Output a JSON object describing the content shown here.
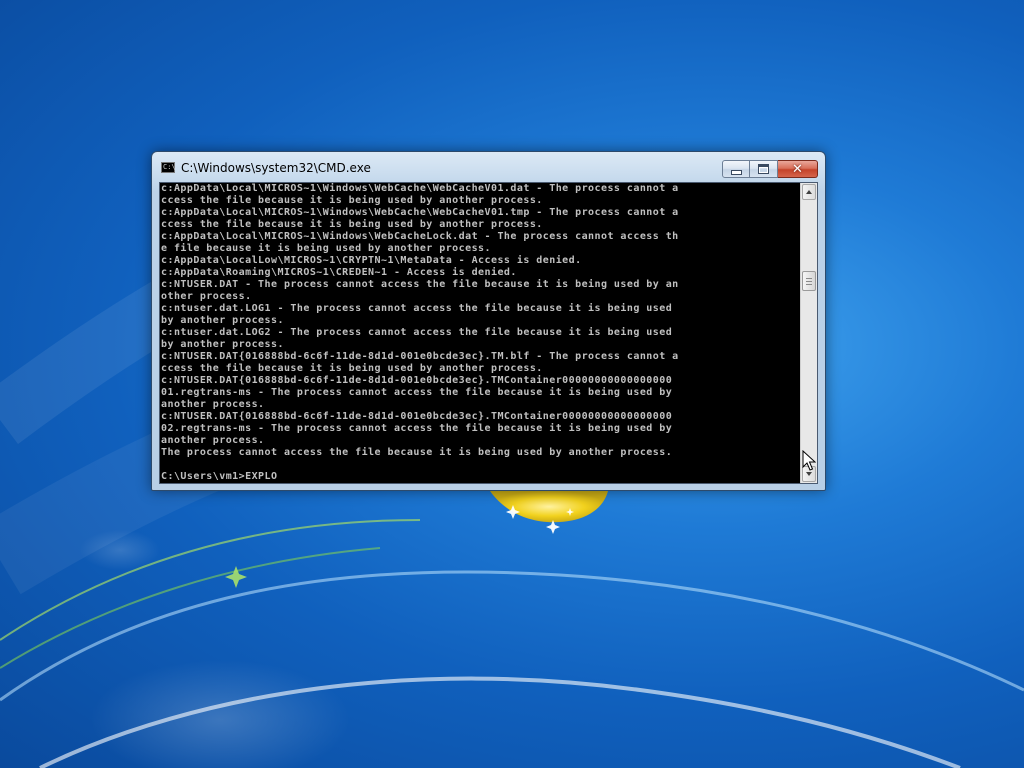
{
  "window": {
    "title": "C:\\Windows\\system32\\CMD.exe",
    "icon_label": "C:\\"
  },
  "console": {
    "lines": [
      "c:AppData\\Local\\MICROS~1\\Windows\\WebCache\\WebCacheV01.dat - The process cannot a",
      "ccess the file because it is being used by another process.",
      "c:AppData\\Local\\MICROS~1\\Windows\\WebCache\\WebCacheV01.tmp - The process cannot a",
      "ccess the file because it is being used by another process.",
      "c:AppData\\Local\\MICROS~1\\Windows\\WebCacheLock.dat - The process cannot access th",
      "e file because it is being used by another process.",
      "c:AppData\\LocalLow\\MICROS~1\\CRYPTN~1\\MetaData - Access is denied.",
      "c:AppData\\Roaming\\MICROS~1\\CREDEN~1 - Access is denied.",
      "c:NTUSER.DAT - The process cannot access the file because it is being used by an",
      "other process.",
      "c:ntuser.dat.LOG1 - The process cannot access the file because it is being used",
      "by another process.",
      "c:ntuser.dat.LOG2 - The process cannot access the file because it is being used",
      "by another process.",
      "c:NTUSER.DAT{016888bd-6c6f-11de-8d1d-001e0bcde3ec}.TM.blf - The process cannot a",
      "ccess the file because it is being used by another process.",
      "c:NTUSER.DAT{016888bd-6c6f-11de-8d1d-001e0bcde3ec}.TMContainer00000000000000000",
      "01.regtrans-ms - The process cannot access the file because it is being used by",
      "another process.",
      "c:NTUSER.DAT{016888bd-6c6f-11de-8d1d-001e0bcde3ec}.TMContainer00000000000000000",
      "02.regtrans-ms - The process cannot access the file because it is being used by",
      "another process.",
      "The process cannot access the file because it is being used by another process."
    ],
    "prompt": "C:\\Users\\vm1>EXPLO"
  },
  "colors": {
    "console_bg": "#000000",
    "console_fg": "#c0c0c0",
    "desktop_blue": "#1f7bd6",
    "close_red": "#c5432a"
  },
  "icons": {
    "app": "cmd-app-icon",
    "minimize": "minimize-icon",
    "maximize": "maximize-icon",
    "close": "close-icon",
    "cursor": "mouse-pointer-icon"
  }
}
